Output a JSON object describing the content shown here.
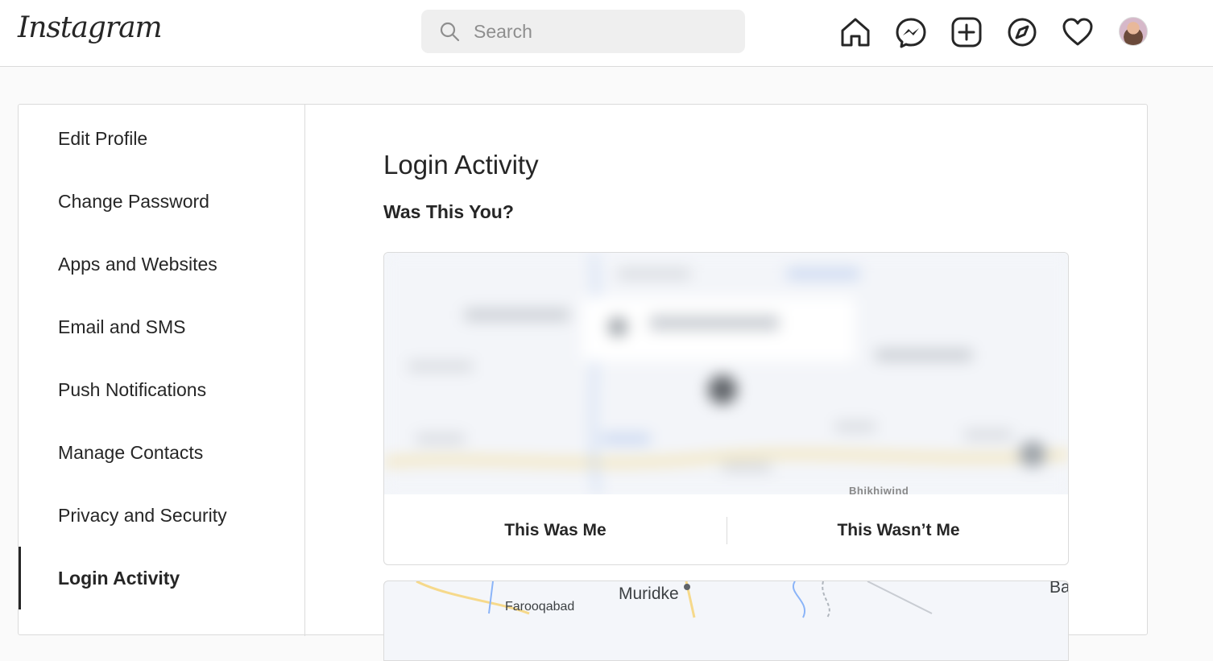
{
  "header": {
    "logo_text": "Instagram",
    "search_placeholder": "Search",
    "icons": [
      "home-icon",
      "messenger-icon",
      "new-post-icon",
      "explore-icon",
      "activity-heart-icon",
      "profile-avatar"
    ]
  },
  "sidebar": {
    "items": [
      {
        "label": "Edit Profile"
      },
      {
        "label": "Change Password"
      },
      {
        "label": "Apps and Websites"
      },
      {
        "label": "Email and SMS"
      },
      {
        "label": "Push Notifications"
      },
      {
        "label": "Manage Contacts"
      },
      {
        "label": "Privacy and Security"
      },
      {
        "label": "Login Activity",
        "active": true
      }
    ]
  },
  "main": {
    "title": "Login Activity",
    "subtitle": "Was This You?",
    "card": {
      "map_labels": [
        "Bhikhiwind"
      ],
      "confirm_label": "This Was Me",
      "deny_label": "This Wasn’t Me"
    },
    "second_map_labels": [
      "Muridke",
      "Farooqabad",
      "Ba"
    ]
  },
  "colors": {
    "border": "#dbdbdb",
    "text": "#262626",
    "muted": "#8e8e8e",
    "background": "#fafafa"
  }
}
